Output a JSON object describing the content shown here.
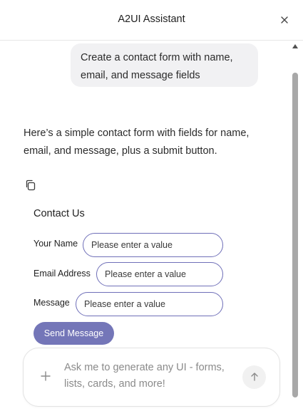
{
  "header": {
    "title": "A2UI Assistant",
    "close_icon": "close-icon"
  },
  "conversation": {
    "user_message": "Create a contact form with name, email, and message fields",
    "assistant_message": "Here’s a simple contact form with fields for name, email, and message, plus a submit button.",
    "copy_icon": "copy-icon"
  },
  "contact_form": {
    "title": "Contact Us",
    "fields": [
      {
        "label": "Your Name",
        "placeholder": "Please enter a value",
        "value": ""
      },
      {
        "label": "Email Address",
        "placeholder": "Please enter a value",
        "value": ""
      },
      {
        "label": "Message",
        "placeholder": "Please enter a value",
        "value": ""
      }
    ],
    "submit_label": "Send Message",
    "accent_color": "#7476b8"
  },
  "composer": {
    "placeholder": "Ask me to generate any UI - forms, lists, cards, and more!",
    "value": "",
    "plus_icon": "plus-icon",
    "send_icon": "arrow-up-icon"
  }
}
